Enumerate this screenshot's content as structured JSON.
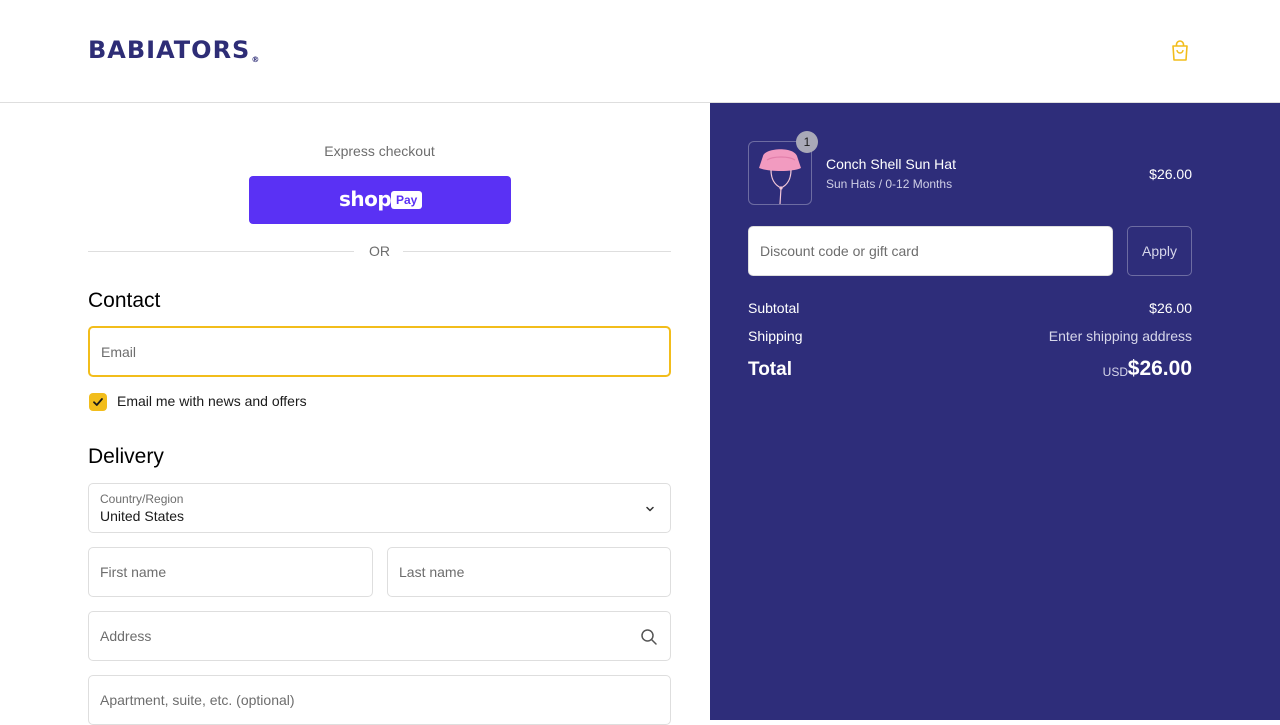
{
  "header": {
    "logo": "BABIATORS",
    "logo_mark": "®",
    "cart_icon": "shopping-bag-icon"
  },
  "express": {
    "label": "Express checkout",
    "shop_word": "shop",
    "pay_badge": "Pay",
    "or_text": "OR"
  },
  "contact": {
    "title": "Contact",
    "email_placeholder": "Email",
    "newsletter_label": "Email me with news and offers",
    "newsletter_checked": true
  },
  "delivery": {
    "title": "Delivery",
    "country_label": "Country/Region",
    "country_value": "United States",
    "first_name_placeholder": "First name",
    "last_name_placeholder": "Last name",
    "address_placeholder": "Address",
    "apartment_placeholder": "Apartment, suite, etc. (optional)"
  },
  "summary": {
    "item": {
      "quantity": "1",
      "name": "Conch Shell Sun Hat",
      "variant": "Sun Hats / 0-12 Months",
      "price": "$26.00"
    },
    "discount_placeholder": "Discount code or gift card",
    "apply_label": "Apply",
    "subtotal_label": "Subtotal",
    "subtotal_value": "$26.00",
    "shipping_label": "Shipping",
    "shipping_value": "Enter shipping address",
    "total_label": "Total",
    "total_currency": "USD",
    "total_value": "$26.00"
  },
  "colors": {
    "accent": "#f2bd1b",
    "brand": "#2e2d76",
    "shop_pay": "#5a31f4",
    "summary_bg": "#2e2d7a"
  }
}
